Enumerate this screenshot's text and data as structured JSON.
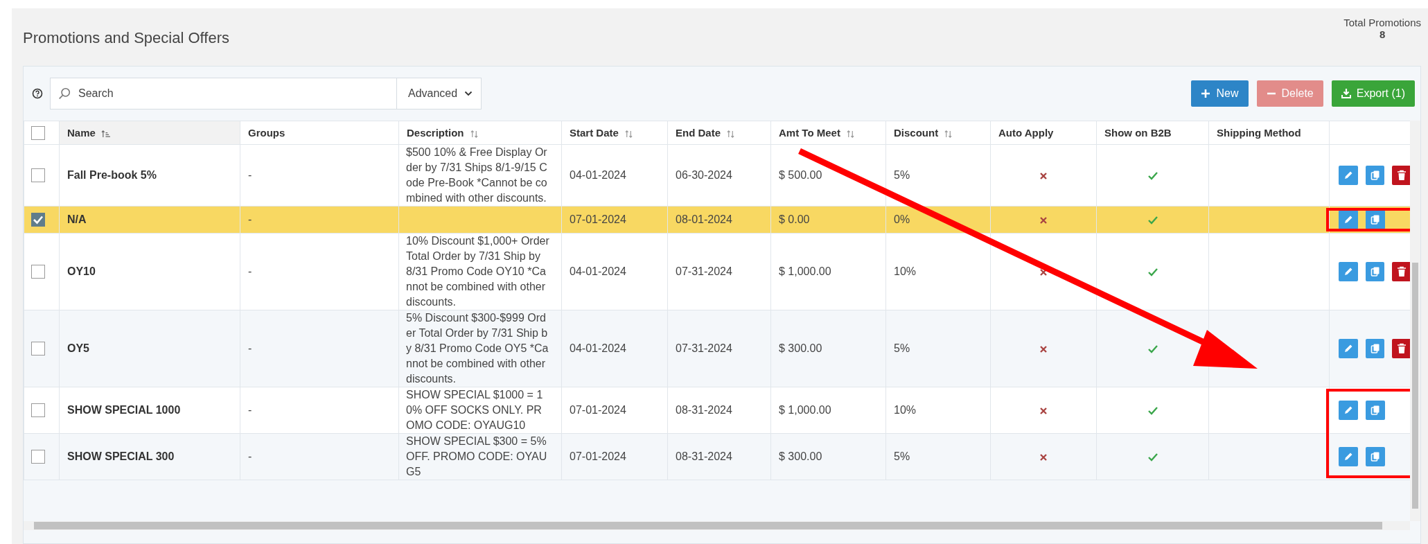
{
  "page": {
    "title": "Promotions and Special Offers",
    "total_label": "Total Promotions",
    "total_value": "8"
  },
  "toolbar": {
    "search_placeholder": "Search",
    "advanced_label": "Advanced",
    "buttons": [
      {
        "kind": "new",
        "label": "New",
        "disabled": false
      },
      {
        "kind": "delete",
        "label": "Delete",
        "disabled": true
      },
      {
        "kind": "export",
        "label": "Export (1)",
        "disabled": false
      }
    ]
  },
  "table": {
    "select_all_checked": false,
    "columns": [
      {
        "label": "Name",
        "sortable": true,
        "sorted": true
      },
      {
        "label": "Groups",
        "sortable": false,
        "sorted": false
      },
      {
        "label": "Description",
        "sortable": true,
        "sorted": false
      },
      {
        "label": "Start Date",
        "sortable": true,
        "sorted": false
      },
      {
        "label": "End Date",
        "sortable": true,
        "sorted": false
      },
      {
        "label": "Amt To Meet",
        "sortable": true,
        "sorted": false
      },
      {
        "label": "Discount",
        "sortable": true,
        "sorted": false
      },
      {
        "label": "Auto Apply",
        "sortable": false,
        "sorted": false
      },
      {
        "label": "Show on B2B",
        "sortable": false,
        "sorted": false
      },
      {
        "label": "Shipping Method",
        "sortable": false,
        "sorted": false
      }
    ],
    "rows": [
      {
        "selected": false,
        "name": "Fall Pre-book 5%",
        "groups": "-",
        "description": "$500 10% & Free Display Order by 7/31 Ships 8/1-9/15 Code Pre-Book *Cannot be combined with other discounts.",
        "start_date": "04-01-2024",
        "end_date": "06-30-2024",
        "amount": "$ 500.00",
        "discount": "5%",
        "auto_apply": false,
        "show_on_b2b": true,
        "deletable": true,
        "highlighted": false
      },
      {
        "selected": true,
        "name": "N/A",
        "groups": "-",
        "start_date": "07-01-2024",
        "end_date": "08-01-2024",
        "amount": "$ 0.00",
        "discount": "0%",
        "auto_apply": false,
        "show_on_b2b": true,
        "deletable": false,
        "highlighted": true
      },
      {
        "selected": false,
        "name": "OY10",
        "groups": "-",
        "description": "10% Discount $1,000+ Order Total Order by 7/31 Ship by 8/31 Promo Code OY10 *Cannot be combined with other discounts.",
        "start_date": "04-01-2024",
        "end_date": "07-31-2024",
        "amount": "$ 1,000.00",
        "discount": "10%",
        "auto_apply": false,
        "show_on_b2b": true,
        "deletable": true,
        "highlighted": false
      },
      {
        "selected": false,
        "name": "OY5",
        "groups": "-",
        "description": "5% Discount $300-$999 Order Total Order by 7/31 Ship by 8/31 Promo Code OY5 *Cannot be combined with other discounts.",
        "start_date": "04-01-2024",
        "end_date": "07-31-2024",
        "amount": "$ 300.00",
        "discount": "5%",
        "auto_apply": false,
        "show_on_b2b": true,
        "deletable": true,
        "highlighted": false
      },
      {
        "selected": false,
        "name": "SHOW SPECIAL 1000",
        "groups": "-",
        "description": "SHOW SPECIAL $1000 = 10% OFF SOCKS ONLY. PROMO CODE: OYAUG10",
        "start_date": "07-01-2024",
        "end_date": "08-31-2024",
        "amount": "$ 1,000.00",
        "discount": "10%",
        "auto_apply": false,
        "show_on_b2b": true,
        "deletable": false,
        "highlighted": true
      },
      {
        "selected": false,
        "name": "SHOW SPECIAL 300",
        "groups": "-",
        "description": "SHOW SPECIAL $300 = 5% OFF. PROMO CODE: OYAUG5",
        "start_date": "07-01-2024",
        "end_date": "08-31-2024",
        "amount": "$ 300.00",
        "discount": "5%",
        "auto_apply": false,
        "show_on_b2b": true,
        "deletable": false,
        "highlighted": true
      }
    ]
  }
}
